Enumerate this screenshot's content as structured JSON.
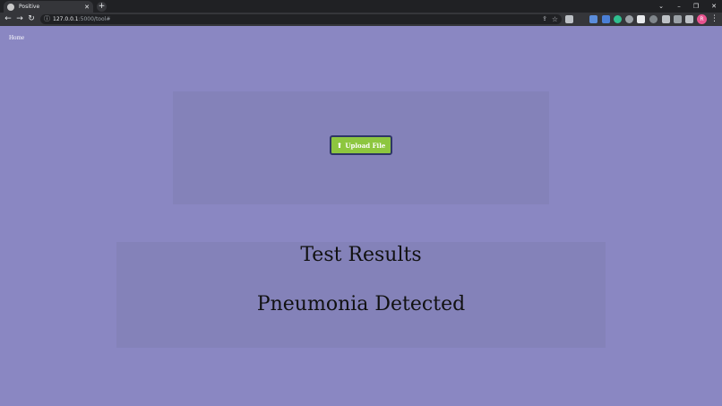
{
  "browser": {
    "tab_title": "Positive",
    "tab_close": "✕",
    "new_tab": "+",
    "url_host": "127.0.0.1",
    "url_path": ":5000/tool#",
    "profile_initial": "R",
    "window_controls": [
      "⌄",
      "–",
      "❐",
      "✕"
    ]
  },
  "nav": {
    "home_label": "Home"
  },
  "upload": {
    "button_label": "Upload File",
    "icon": "upload-icon"
  },
  "results": {
    "title": "Test Results",
    "value": "Pneumonia Detected"
  },
  "colors": {
    "page_background": "#8a87c2",
    "panel_background": "#8482b9",
    "upload_button": "#8dc63f",
    "upload_border": "#2e3566"
  }
}
